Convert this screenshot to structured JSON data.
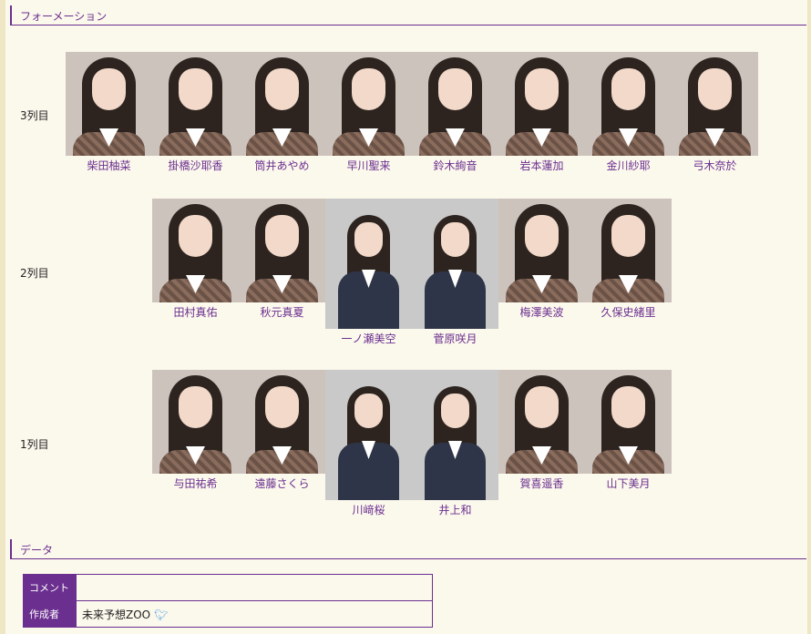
{
  "formation_header": "フォーメーション",
  "rows": [
    {
      "label": "3列目",
      "members": [
        "柴田柚菜",
        "掛橋沙耶香",
        "筒井あやめ",
        "早川聖来",
        "鈴木絢音",
        "岩本蓮加",
        "金川紗耶",
        "弓木奈於"
      ]
    },
    {
      "label": "2列目",
      "members": [
        "田村真佑",
        "秋元真夏",
        "一ノ瀬美空",
        "菅原咲月",
        "梅澤美波",
        "久保史緒里"
      ]
    },
    {
      "label": "1列目",
      "members": [
        "与田祐希",
        "遠藤さくら",
        "川﨑桜",
        "井上和",
        "賀喜遥香",
        "山下美月"
      ]
    }
  ],
  "data_header": "データ",
  "data_table": {
    "comment_label": "コメント",
    "comment_value": "",
    "author_label": "作成者",
    "author_value": "未来予想ZOO"
  },
  "icons": {
    "author": "twitter-bird-icon"
  },
  "colors": {
    "accent": "#6b2f8f",
    "background": "#fbf8ec"
  }
}
